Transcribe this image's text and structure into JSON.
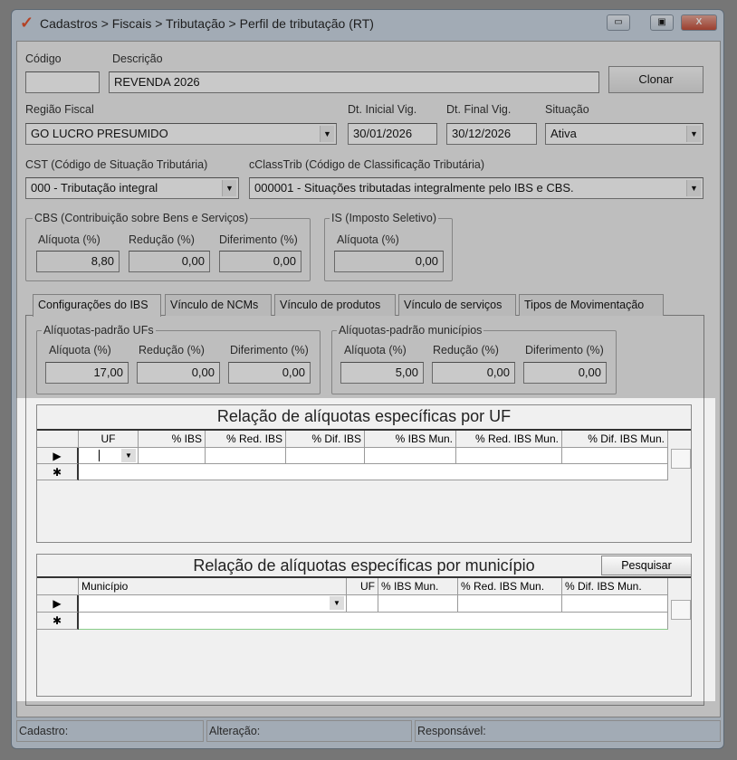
{
  "window": {
    "title": "Cadastros > Fiscais > Tributação > Perfil de tributação (RT)",
    "minimize": "▭",
    "maximize": "▣",
    "close": "X"
  },
  "form": {
    "codigo_label": "Código",
    "codigo_value": "",
    "descricao_label": "Descrição",
    "descricao_value": "REVENDA 2026",
    "clonar": "Clonar",
    "regiao_label": "Região Fiscal",
    "regiao_value": "GO LUCRO PRESUMIDO",
    "dt_inicial_label": "Dt. Inicial Vig.",
    "dt_inicial_value": "30/01/2026",
    "dt_final_label": "Dt. Final Vig.",
    "dt_final_value": "30/12/2026",
    "situacao_label": "Situação",
    "situacao_value": "Ativa",
    "cst_label": "CST (Código de Situação Tributária)",
    "cst_value": "000 - Tributação integral",
    "cclass_label": "cClassTrib (Código de Classificação Tributária)",
    "cclass_value": "000001 - Situações tributadas integralmente pelo IBS e CBS."
  },
  "cbs": {
    "title": "CBS (Contribuição sobre Bens e Serviços)",
    "aliquota_label": "Alíquota (%)",
    "aliquota": "8,80",
    "reducao_label": "Redução (%)",
    "reducao": "0,00",
    "diferimento_label": "Diferimento (%)",
    "diferimento": "0,00"
  },
  "is": {
    "title": "IS (Imposto Seletivo)",
    "aliquota_label": "Alíquota (%)",
    "aliquota": "0,00"
  },
  "tabs": [
    "Configurações do IBS",
    "Vínculo de NCMs",
    "Vínculo de produtos",
    "Vínculo de serviços",
    "Tipos de Movimentação"
  ],
  "ufs": {
    "title": "Alíquotas-padrão UFs",
    "aliquota_label": "Alíquota (%)",
    "aliquota": "17,00",
    "reducao_label": "Redução (%)",
    "reducao": "0,00",
    "diferimento_label": "Diferimento (%)",
    "diferimento": "0,00"
  },
  "mun": {
    "title": "Alíquotas-padrão municípios",
    "aliquota_label": "Alíquota (%)",
    "aliquota": "5,00",
    "reducao_label": "Redução (%)",
    "reducao": "0,00",
    "diferimento_label": "Diferimento (%)",
    "diferimento": "0,00"
  },
  "grid_uf": {
    "title": "Relação de alíquotas específicas por UF",
    "columns": [
      "UF",
      "% IBS",
      "% Red. IBS",
      "% Dif. IBS",
      "% IBS Mun.",
      "% Red. IBS Mun.",
      "% Dif. IBS Mun."
    ]
  },
  "grid_mun": {
    "title": "Relação de alíquotas específicas por município",
    "search": "Pesquisar",
    "columns": [
      "Município",
      "UF",
      "% IBS Mun.",
      "% Red. IBS Mun.",
      "% Dif. IBS Mun."
    ]
  },
  "row_markers": {
    "current": "▶",
    "new": "✱"
  },
  "status": {
    "cadastro": "Cadastro:",
    "alteracao": "Alteração:",
    "responsavel": "Responsável:"
  }
}
